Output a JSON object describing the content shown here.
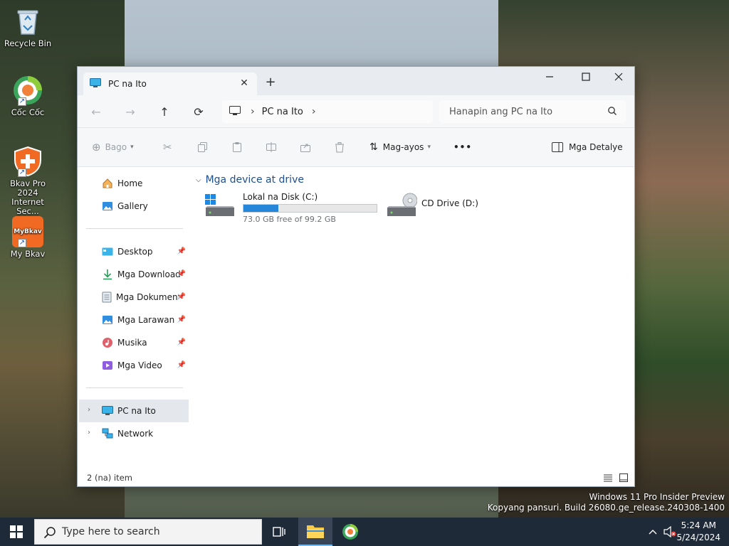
{
  "desktop": {
    "icons": [
      {
        "label": "Recycle Bin"
      },
      {
        "label": "Cốc Cốc"
      },
      {
        "label": "Bkav Pro 2024 Internet Sec..."
      },
      {
        "label": "My Bkav",
        "badge": "MyBkav"
      }
    ],
    "watermark": {
      "line1": "Windows 11 Pro Insider Preview",
      "line2": "Kopyang pansuri. Build 26080.ge_release.240308-1400"
    }
  },
  "window": {
    "tab": {
      "label": "PC na Ito"
    },
    "address": {
      "location": "PC na Ito"
    },
    "search": {
      "placeholder": "Hanapin ang PC na Ito"
    },
    "commands": {
      "new": "Bago",
      "sort": "Mag-ayos",
      "more": "•••",
      "details": "Mga Detalye"
    },
    "sidebar": {
      "top": [
        {
          "label": "Home",
          "icon": "home-icon"
        },
        {
          "label": "Gallery",
          "icon": "gallery-icon"
        }
      ],
      "quick": [
        {
          "label": "Desktop",
          "icon": "desktop-folder-icon"
        },
        {
          "label": "Mga Download",
          "icon": "download-icon"
        },
        {
          "label": "Mga Dokumento",
          "icon": "documents-icon"
        },
        {
          "label": "Mga Larawan",
          "icon": "pictures-icon"
        },
        {
          "label": "Musika",
          "icon": "music-icon"
        },
        {
          "label": "Mga Video",
          "icon": "videos-icon"
        }
      ],
      "bottom": [
        {
          "label": "PC na Ito",
          "icon": "this-pc-icon",
          "selected": true
        },
        {
          "label": "Network",
          "icon": "network-icon"
        }
      ]
    },
    "content": {
      "group_header": "Mga device at drive",
      "drives": [
        {
          "name": "Lokal na Disk (C:)",
          "free_text": "73.0 GB free of 99.2 GB",
          "used_fraction": 0.264,
          "icon": "local-disk-icon"
        },
        {
          "name": "CD Drive (D:)",
          "icon": "cd-drive-icon"
        }
      ]
    },
    "status": {
      "items": "2 (na) item"
    }
  },
  "taskbar": {
    "search_placeholder": "Type here to search",
    "clock": {
      "time": "5:24 AM",
      "date": "5/24/2024"
    }
  },
  "colors": {
    "accent": "#2686d9",
    "taskbar": "#1f2a38",
    "group_header": "#1d4f91"
  }
}
